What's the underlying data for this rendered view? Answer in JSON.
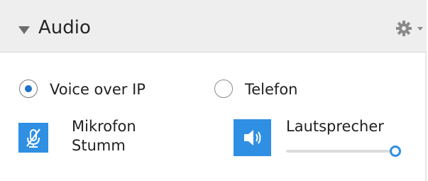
{
  "panel": {
    "title": "Audio",
    "header_icons": [
      "collapse-arrow-icon",
      "gear-icon",
      "chevron-down-icon"
    ]
  },
  "connection": {
    "options": [
      {
        "label": "Voice over IP",
        "selected": true
      },
      {
        "label": "Telefon",
        "selected": false
      }
    ]
  },
  "microphone": {
    "label_line1": "Mikrofon",
    "label_line2": "Stumm",
    "icon": "microphone-muted-icon",
    "muted": true
  },
  "speaker": {
    "label": "Lautsprecher",
    "icon": "speaker-icon",
    "volume": 1.0
  },
  "colors": {
    "accent": "#2f8fe3",
    "radio_selected": "#1e72c9",
    "header_bg": "#eeeeee"
  }
}
